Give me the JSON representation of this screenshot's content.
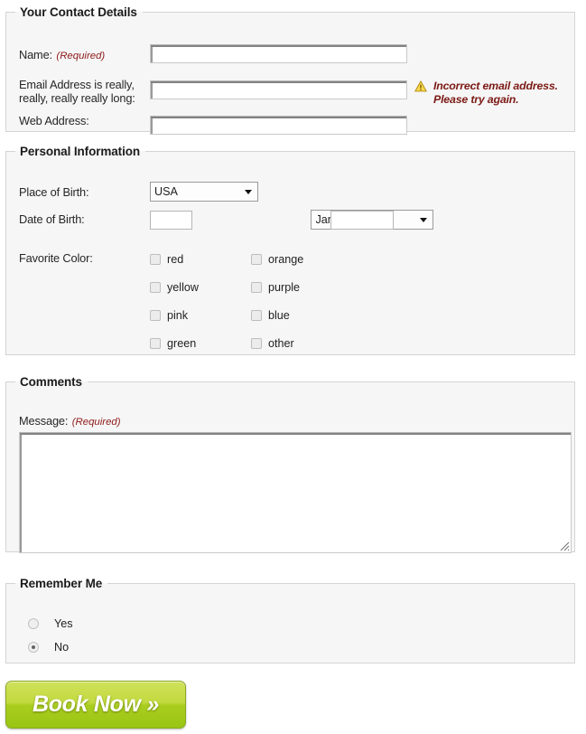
{
  "sections": {
    "contact": {
      "legend": "Your Contact Details",
      "fields": [
        {
          "label": "Name:",
          "required_note": "(Required)",
          "value": "",
          "placeholder": ""
        },
        {
          "label": "Email Address is really, really, really really long:",
          "required_note": "",
          "value": "",
          "placeholder": ""
        },
        {
          "label": "Web Address:",
          "required_note": "",
          "value": "",
          "placeholder": ""
        }
      ],
      "error": {
        "icon": "warning-triangle-icon",
        "line1": "Incorrect email address.",
        "line2": "Please try again.",
        "color": "#7c1a15"
      }
    },
    "personal": {
      "legend": "Personal Information",
      "place_of_birth": {
        "label": "Place of Birth:",
        "selected": "USA",
        "options": [
          "USA"
        ]
      },
      "date_of_birth": {
        "label": "Date of Birth:",
        "day_value": "",
        "month_selected": "January",
        "month_options": [
          "January"
        ],
        "year_value": ""
      },
      "favorite_color": {
        "label": "Favorite Color:",
        "options": [
          {
            "label": "red",
            "checked": false
          },
          {
            "label": "orange",
            "checked": false
          },
          {
            "label": "yellow",
            "checked": false
          },
          {
            "label": "purple",
            "checked": false
          },
          {
            "label": "pink",
            "checked": false
          },
          {
            "label": "blue",
            "checked": false
          },
          {
            "label": "green",
            "checked": false
          },
          {
            "label": "other",
            "checked": false
          }
        ]
      }
    },
    "comments": {
      "legend": "Comments",
      "message_label": "Message:",
      "required_note": "(Required)",
      "message_value": "",
      "message_placeholder": ""
    },
    "remember": {
      "legend": "Remember Me",
      "options": [
        {
          "label": "Yes",
          "checked": false
        },
        {
          "label": "No",
          "checked": true
        }
      ]
    }
  },
  "submit": {
    "label": "Book Now »",
    "color": "#a9cd1f"
  }
}
